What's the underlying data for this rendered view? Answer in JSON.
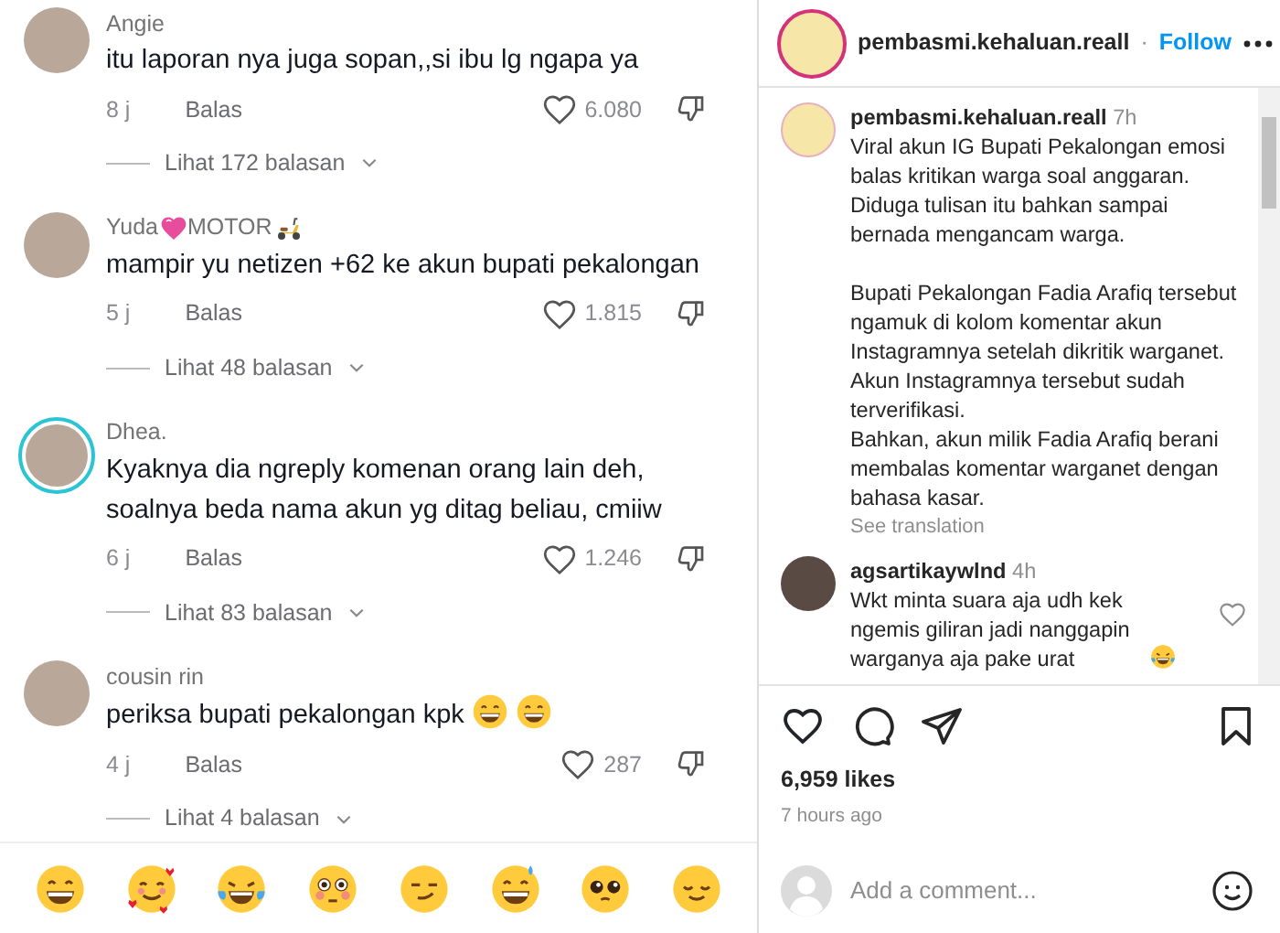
{
  "comments_panel": {
    "comments": [
      {
        "name": [
          {
            "kind": "text",
            "text": "Angie"
          }
        ],
        "has_story": false,
        "body": "itu laporan nya juga sopan,,si ibu lg ngapa ya",
        "time": "8 j",
        "reply": "Balas",
        "likes": "6.080",
        "more_replies": "Lihat 172 balasan"
      },
      {
        "name": [
          {
            "kind": "text",
            "text": "Yuda"
          },
          {
            "kind": "heart"
          },
          {
            "kind": "text",
            "text": "MOTOR"
          },
          {
            "kind": "scooter"
          }
        ],
        "has_story": false,
        "body": "mampir yu netizen +62 ke akun bupati pekalongan",
        "time": "5 j",
        "reply": "Balas",
        "likes": "1.815",
        "more_replies": "Lihat 48 balasan"
      },
      {
        "name": [
          {
            "kind": "text",
            "text": "Dhea."
          }
        ],
        "has_story": true,
        "body": "Kyaknya dia ngreply komenan orang lain deh, soalnya beda nama akun yg ditag beliau, cmiiw",
        "time": "6 j",
        "reply": "Balas",
        "likes": "1.246",
        "more_replies": "Lihat 83 balasan"
      },
      {
        "name": [
          {
            "kind": "text",
            "text": "cousin rin"
          }
        ],
        "has_story": false,
        "body": "periksa bupati pekalongan kpk",
        "emojis": [
          {
            "kind": "grin"
          },
          {
            "kind": "grin"
          }
        ],
        "time": "4 j",
        "reply": "Balas",
        "likes": "287",
        "more_replies": "Lihat 4 balasan"
      }
    ],
    "emoji_bar": [
      {
        "kind": "grin"
      },
      {
        "kind": "hearts"
      },
      {
        "kind": "tears-of-joy"
      },
      {
        "kind": "flushed"
      },
      {
        "kind": "smirk"
      },
      {
        "kind": "sweat-grin"
      },
      {
        "kind": "pleading"
      },
      {
        "kind": "relieved"
      }
    ]
  },
  "post_panel": {
    "header": {
      "username": "pembasmi.kehaluan.reall",
      "separator": "·",
      "follow": "Follow"
    },
    "caption": {
      "username": "pembasmi.kehaluan.reall",
      "time": "7h",
      "blocks": [
        [
          "Viral akun IG Bupati Pekalongan emosi balas kritikan warga soal anggaran. Diduga tulisan itu bahkan sampai bernada mengancam warga."
        ],
        [
          "Bupati Pekalongan Fadia Arafiq tersebut ngamuk di kolom komentar akun Instagramnya setelah dikritik warganet. Akun Instagramnya tersebut sudah terverifikasi.",
          "Bahkan, akun milik Fadia Arafiq berani membalas komentar warganet dengan bahasa kasar."
        ]
      ],
      "see_translation": "See translation"
    },
    "comment": {
      "username": "agsartikaywlnd",
      "time": "4h",
      "body": "Wkt minta suara aja udh kek ngemis giliran jadi nanggapin warganya aja pake urat",
      "emojis": [
        {
          "kind": "tears-of-joy"
        }
      ]
    },
    "likes": "6,959 likes",
    "posted": "7 hours ago",
    "add_comment": {
      "placeholder": "Add a comment..."
    }
  }
}
